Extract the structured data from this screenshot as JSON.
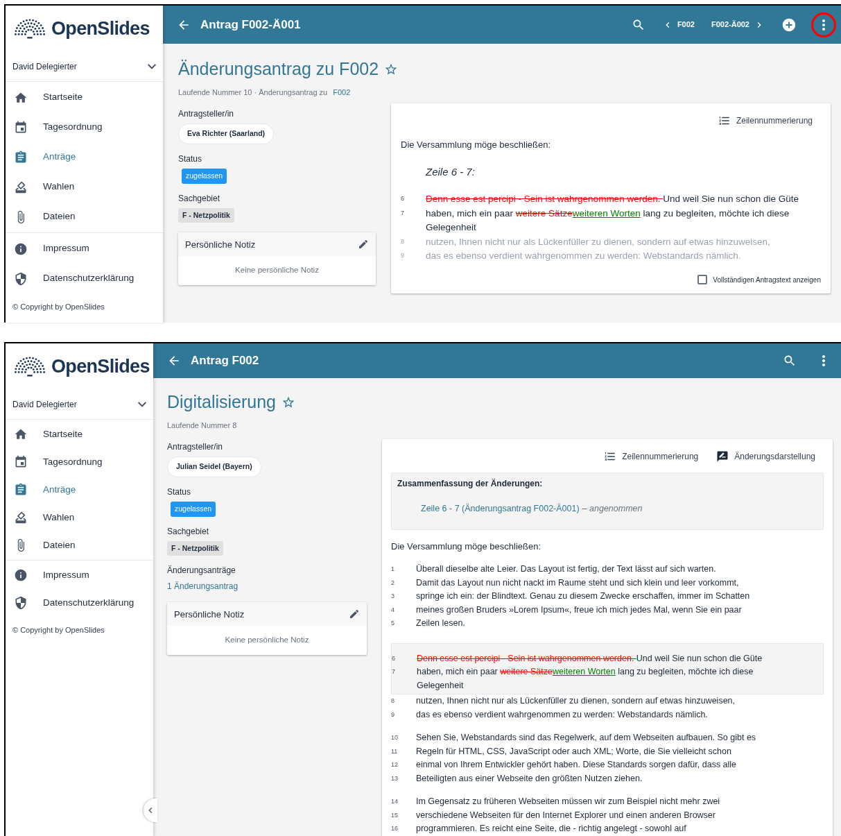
{
  "screens": [
    {
      "sidebar": {
        "brand": "OpenSlides",
        "user": "David Delegierter",
        "nav": [
          {
            "label": "Startseite",
            "selected": false
          },
          {
            "label": "Tagesordnung",
            "selected": false
          },
          {
            "label": "Anträge",
            "selected": true
          },
          {
            "label": "Wahlen",
            "selected": false
          },
          {
            "label": "Dateien",
            "selected": false
          }
        ],
        "legal": [
          "Impressum",
          "Datenschutzerklärung"
        ],
        "copyright": "© Copyright by OpenSlides"
      },
      "toolbar": {
        "title": "Antrag F002-Ä001",
        "actions": [
          {
            "kind": "search"
          },
          {
            "kind": "prev",
            "label": "F002"
          },
          {
            "kind": "next",
            "label": "F002-Ä002"
          },
          {
            "kind": "add"
          },
          {
            "kind": "menu",
            "highlighted": true
          }
        ]
      },
      "header": {
        "title": "Änderungsantrag zu F002",
        "starred": false,
        "subtitle": "Laufende Nummer 10 · Änderungsantrag zu",
        "subtitle_link": "F002"
      },
      "fields": [
        {
          "label": "Antragsteller/in",
          "kind": "chip",
          "value": "Eva Richter (Saarland)"
        },
        {
          "label": "Status",
          "kind": "status",
          "value": "zugelassen"
        },
        {
          "label": "Sachgebiet",
          "kind": "category",
          "value": "F - Netzpolitik"
        }
      ],
      "note": {
        "title": "Persönliche Notiz",
        "empty_text": "Keine persönliche Notiz"
      },
      "card": {
        "toggles": [
          {
            "kind": "line_numbering",
            "label": "Zeilennummerierung"
          }
        ],
        "preamble": "Die Versammlung möge beschließen:",
        "blocks": [
          {
            "kind": "excerpt",
            "heading": "Zeile 6 - 7:",
            "lines": [
              {
                "number": "6",
                "faded": false,
                "segments": [
                  {
                    "kind": "deleted",
                    "text": "Denn esse est percipi - Sein ist wahrgenommen werden. "
                  },
                  {
                    "kind": "normal",
                    "text": "Und weil Sie nun schon die Güte"
                  }
                ]
              },
              {
                "number": "7",
                "faded": false,
                "segments": [
                  {
                    "kind": "normal",
                    "text": "haben, mich ein paar "
                  },
                  {
                    "kind": "deleted",
                    "text": "weitere Sätze"
                  },
                  {
                    "kind": "inserted",
                    "text": "weiteren Worten"
                  },
                  {
                    "kind": "normal",
                    "text": " lang zu begleiten, möchte ich diese"
                  },
                  {
                    "kind": "wrapped",
                    "text": "Gelegenheit"
                  }
                ]
              },
              {
                "number": "8",
                "faded": true,
                "text": "nutzen, Ihnen nicht nur als Lückenfüller zu dienen, sondern auf etwas hinzuweisen,"
              },
              {
                "number": "9",
                "faded": true,
                "text": "das es ebenso verdient wahrgenommen zu werden: Webstandards nämlich."
              }
            ]
          }
        ],
        "checkbox": {
          "label": "Vollständigen Antragstext anzeigen",
          "checked": false
        }
      }
    },
    {
      "sidebar": {
        "brand": "OpenSlides",
        "user": "David Delegierter",
        "nav": [
          {
            "label": "Startseite",
            "selected": false
          },
          {
            "label": "Tagesordnung",
            "selected": false
          },
          {
            "label": "Anträge",
            "selected": true
          },
          {
            "label": "Wahlen",
            "selected": false
          },
          {
            "label": "Dateien",
            "selected": false
          }
        ],
        "legal": [
          "Impressum",
          "Datenschutzerklärung"
        ],
        "copyright": "© Copyright by OpenSlides",
        "collapse_toggle": true
      },
      "toolbar": {
        "title": "Antrag F002",
        "actions": [
          {
            "kind": "search"
          },
          {
            "kind": "menu",
            "highlighted": false
          }
        ]
      },
      "header": {
        "title": "Digitalisierung",
        "starred": false,
        "subtitle": "Laufende Nummer 8"
      },
      "fields": [
        {
          "label": "Antragsteller/in",
          "kind": "chip",
          "value": "Julian Seidel (Bayern)"
        },
        {
          "label": "Status",
          "kind": "status",
          "value": "zugelassen"
        },
        {
          "label": "Sachgebiet",
          "kind": "category",
          "value": "F - Netzpolitik"
        },
        {
          "label": "Änderungsanträge",
          "kind": "link",
          "value": "1 Änderungsantrag"
        }
      ],
      "note": {
        "title": "Persönliche Notiz",
        "empty_text": "Keine persönliche Notiz"
      },
      "card": {
        "toggles": [
          {
            "kind": "line_numbering",
            "label": "Zeilennummerierung"
          },
          {
            "kind": "change_view",
            "label": "Änderungsdarstellung"
          }
        ],
        "summary": {
          "heading": "Zusammenfassung der Änderungen:",
          "items": [
            {
              "link": "Zeile 6 - 7 (Änderungsantrag F002-Ä001)",
              "status": "– angenommen"
            }
          ]
        },
        "preamble": "Die Versammlung möge beschließen:",
        "blocks": [
          {
            "kind": "paragraph",
            "lines": [
              {
                "number": "1",
                "faded": false,
                "text": "Überall dieselbe alte Leier. Das Layout ist fertig, der Text lässt auf sich warten."
              },
              {
                "number": "2",
                "faded": false,
                "text": "Damit das Layout nun nicht nackt im Raume steht und sich klein und leer vorkommt,"
              },
              {
                "number": "3",
                "faded": false,
                "text": "springe ich ein: der Blindtext. Genau zu diesem Zwecke erschaffen, immer im Schatten"
              },
              {
                "number": "4",
                "faded": false,
                "text": "meines großen Bruders »Lorem Ipsum«, freue ich mich jedes Mal, wenn Sie ein paar"
              },
              {
                "number": "5",
                "faded": false,
                "text": "Zeilen lesen."
              }
            ]
          },
          {
            "kind": "highlighted",
            "lines": [
              {
                "number": "6",
                "faded": false,
                "segments": [
                  {
                    "kind": "deleted",
                    "text": "Denn esse est percipi - Sein ist wahrgenommen werden. "
                  },
                  {
                    "kind": "normal",
                    "text": "Und weil Sie nun schon die Güte"
                  }
                ]
              },
              {
                "number": "7",
                "faded": false,
                "segments": [
                  {
                    "kind": "normal",
                    "text": "haben, mich ein paar "
                  },
                  {
                    "kind": "deleted",
                    "text": "weitere Sätze"
                  },
                  {
                    "kind": "inserted",
                    "text": "weiteren Worten"
                  },
                  {
                    "kind": "normal",
                    "text": " lang zu begleiten, möchte ich diese"
                  },
                  {
                    "kind": "wrapped",
                    "text": "Gelegenheit"
                  }
                ]
              }
            ]
          },
          {
            "kind": "paragraph",
            "lines": [
              {
                "number": "8",
                "faded": false,
                "text": "nutzen, Ihnen nicht nur als Lückenfüller zu dienen, sondern auf etwas hinzuweisen,"
              },
              {
                "number": "9",
                "faded": false,
                "text": "das es ebenso verdient wahrgenommen zu werden: Webstandards nämlich."
              }
            ]
          },
          {
            "kind": "paragraph",
            "lines": [
              {
                "number": "10",
                "faded": false,
                "text": "Sehen Sie, Webstandards sind das Regelwerk, auf dem Webseiten aufbauen. So gibt es"
              },
              {
                "number": "11",
                "faded": false,
                "text": "Regeln für HTML, CSS, JavaScript oder auch XML; Worte, die Sie vielleicht schon"
              },
              {
                "number": "12",
                "faded": false,
                "text": "einmal von Ihrem Entwickler gehört haben. Diese Standards sorgen dafür, dass alle"
              },
              {
                "number": "13",
                "faded": false,
                "text": "Beteiligten aus einer Webseite den größten Nutzen ziehen."
              }
            ]
          },
          {
            "kind": "paragraph",
            "lines": [
              {
                "number": "14",
                "faded": false,
                "text": "Im Gegensatz zu früheren Webseiten müssen wir zum Beispiel nicht mehr zwei"
              },
              {
                "number": "15",
                "faded": false,
                "text": "verschiedene Webseiten für den Internet Explorer und einen anderen Browser"
              },
              {
                "number": "16",
                "faded": false,
                "text": "programmieren. Es reicht eine Seite, die - richtig angelegt - sowohl auf"
              }
            ]
          }
        ]
      }
    }
  ]
}
